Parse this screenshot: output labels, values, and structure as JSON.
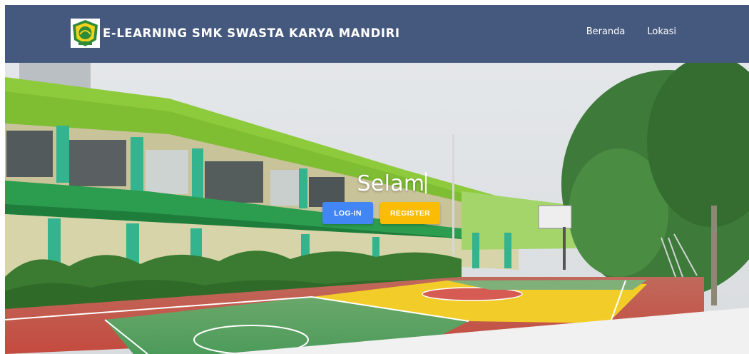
{
  "navbar": {
    "brand_name": "E-LEARNING SMK SWASTA KARYA MANDIRI",
    "logo_icon": "school-crest-icon",
    "links": [
      {
        "label": "Beranda"
      },
      {
        "label": "Lokasi"
      }
    ],
    "background_color": "#45587e"
  },
  "hero": {
    "title_typing": "Selam",
    "buttons": {
      "login_label": "LOG-IN",
      "register_label": "REGISTER"
    },
    "colors": {
      "login": "#4285f4",
      "register": "#fbbc05"
    }
  }
}
